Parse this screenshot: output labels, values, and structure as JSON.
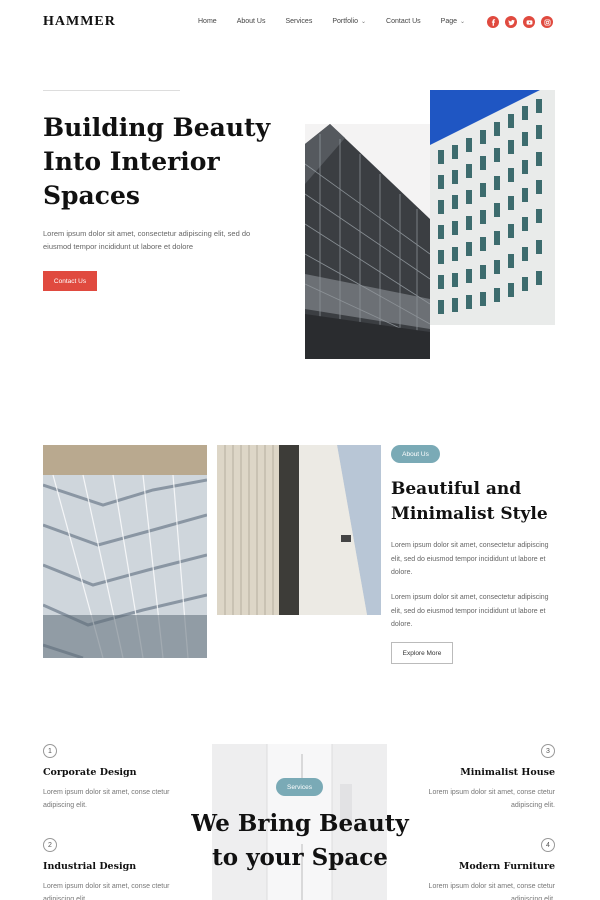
{
  "header": {
    "logo": "HAMMER",
    "nav": [
      {
        "label": "Home"
      },
      {
        "label": "About Us"
      },
      {
        "label": "Services"
      },
      {
        "label": "Portfolio"
      },
      {
        "label": "Contact Us"
      },
      {
        "label": "Page"
      }
    ],
    "socials": [
      "facebook-icon",
      "twitter-icon",
      "youtube-icon",
      "instagram-icon"
    ],
    "accent_color": "#e04a3f"
  },
  "hero": {
    "title_lines": [
      "Building Beauty",
      "Into Interior",
      "Spaces"
    ],
    "description": "Lorem ipsum dolor sit amet, consectetur adipiscing elit, sed do eiusmod tempor incididunt ut labore et dolore",
    "cta_label": "Contact Us"
  },
  "about": {
    "badge": "About Us",
    "title_lines": [
      "Beautiful and",
      "Minimalist Style"
    ],
    "paragraph_1": "Lorem ipsum dolor sit amet, consectetur adipiscing elit, sed do eiusmod tempor incididunt ut labore et dolore.",
    "paragraph_2": "Lorem ipsum dolor sit amet, consectetur adipiscing elit, sed do eiusmod tempor incididunt ut labore et dolore.",
    "button_label": "Explore More",
    "badge_color": "#7aaab6"
  },
  "services": {
    "badge": "Services",
    "heading_lines": [
      "We Bring Beauty",
      "to your Space"
    ],
    "items": [
      {
        "num": "1",
        "title": "Corporate Design",
        "desc": "Lorem ipsum dolor sit amet, conse ctetur adipiscing elit."
      },
      {
        "num": "2",
        "title": "Industrial Design",
        "desc": "Lorem ipsum dolor sit amet, conse ctetur adipiscing elit."
      },
      {
        "num": "3",
        "title": "Minimalist House",
        "desc": "Lorem ipsum dolor sit amet, conse ctetur adipiscing elit."
      },
      {
        "num": "4",
        "title": "Modern Furniture",
        "desc": "Lorem ipsum dolor sit amet, conse ctetur adipiscing elit."
      }
    ]
  }
}
